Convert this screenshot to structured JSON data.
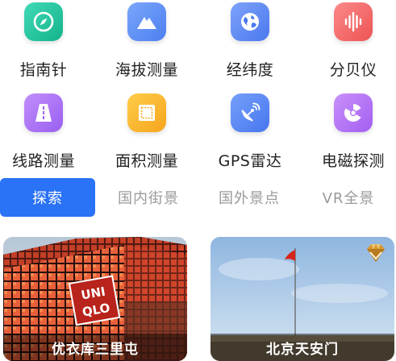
{
  "tools": [
    {
      "label": "指南针",
      "icon": "compass-icon",
      "color": "#23c4a0"
    },
    {
      "label": "海拔测量",
      "icon": "mountain-icon",
      "color": "#5c8ef5"
    },
    {
      "label": "经纬度",
      "icon": "globe-icon",
      "color": "#5a86f2"
    },
    {
      "label": "分贝仪",
      "icon": "soundwave-icon",
      "color": "#f36a6a"
    },
    {
      "label": "线路测量",
      "icon": "road-icon",
      "color": "#a874f3"
    },
    {
      "label": "面积测量",
      "icon": "area-icon",
      "color": "#f8b52e"
    },
    {
      "label": "GPS雷达",
      "icon": "satellite-dish-icon",
      "color": "#4f86f2"
    },
    {
      "label": "电磁探测",
      "icon": "radiation-icon",
      "color": "#b06ef2"
    }
  ],
  "tabs": [
    {
      "label": "探索",
      "active": true
    },
    {
      "label": "国内街景",
      "active": false
    },
    {
      "label": "国外景点",
      "active": false
    },
    {
      "label": "VR全景",
      "active": false
    }
  ],
  "cards": [
    {
      "caption": "优衣库三里屯",
      "logo_text": "UNI QLO"
    },
    {
      "caption": "北京天安门",
      "badge": "diamond-vip-icon"
    }
  ],
  "accent": "#2a72f6"
}
